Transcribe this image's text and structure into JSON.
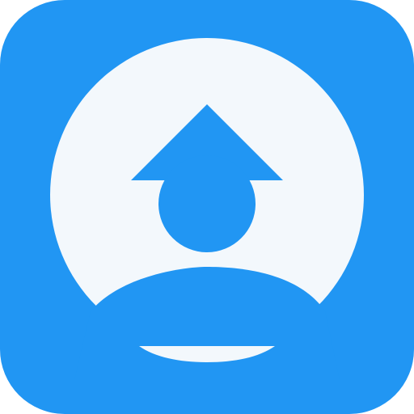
{
  "icon": {
    "name": "upload-user-icon",
    "colors": {
      "tile": "#2196f3",
      "circle": "#f3f8fc",
      "glyph": "#2196f3",
      "bar": "#f3f8fc"
    }
  }
}
